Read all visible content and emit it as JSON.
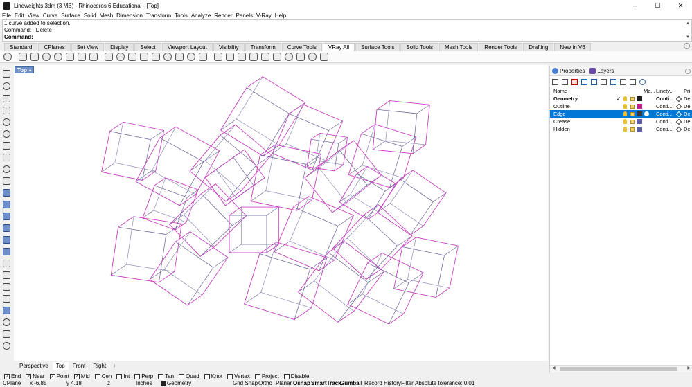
{
  "window": {
    "title": "Lineweights.3dm (3 MB) - Rhinoceros 6 Educational - [Top]",
    "controls": [
      "–",
      "☐",
      "✕"
    ]
  },
  "menu": [
    "File",
    "Edit",
    "View",
    "Curve",
    "Surface",
    "Solid",
    "Mesh",
    "Dimension",
    "Transform",
    "Tools",
    "Analyze",
    "Render",
    "Panels",
    "V-Ray",
    "Help"
  ],
  "command_history": [
    "1 curve added to selection.",
    "Command: _Delete"
  ],
  "command_prompt": "Command:",
  "toolbar_tabs": [
    "Standard",
    "CPlanes",
    "Set View",
    "Display",
    "Select",
    "Viewport Layout",
    "Visibility",
    "Transform",
    "Curve Tools",
    "VRay All",
    "Surface Tools",
    "Solid Tools",
    "Mesh Tools",
    "Render Tools",
    "Drafting",
    "New in V6"
  ],
  "active_toolbar_tab": "VRay All",
  "viewport": {
    "label": "Top",
    "caret": "▾",
    "tabs": [
      "Perspective",
      "Top",
      "Front",
      "Right"
    ],
    "active_tab": "Top",
    "add_tab": "+"
  },
  "panel": {
    "tabs": [
      {
        "label": "Properties",
        "icon": "properties-icon",
        "color": "#4a7fcf"
      },
      {
        "label": "Layers",
        "icon": "layers-icon",
        "color": "#6a4ca8"
      }
    ],
    "columns": {
      "name": "Name",
      "material": "Ma...",
      "linetype": "Linety...",
      "print": "Pri"
    },
    "layers": [
      {
        "name": "Geometry",
        "current": true,
        "check": "✓",
        "color": "#1a1a1a",
        "material": "",
        "linetype": "Conti...",
        "print": "De",
        "bold": true,
        "selected": false
      },
      {
        "name": "Outline",
        "current": false,
        "check": "",
        "color": "#c0208c",
        "material": "",
        "linetype": "Conti...",
        "print": "De",
        "bold": false,
        "selected": false
      },
      {
        "name": "Edge",
        "current": false,
        "check": "",
        "color": "#3a3a3a",
        "material": "#ffffff",
        "linetype": "Conti...",
        "print": "De",
        "bold": false,
        "selected": true
      },
      {
        "name": "Crease",
        "current": false,
        "check": "",
        "color": "#5b5ba8",
        "material": "",
        "linetype": "Conti...",
        "print": "De",
        "bold": false,
        "selected": false
      },
      {
        "name": "Hidden",
        "current": false,
        "check": "",
        "color": "#5b5ba8",
        "material": "",
        "linetype": "Conti...",
        "print": "De",
        "bold": false,
        "selected": false
      }
    ]
  },
  "osnaps": [
    {
      "label": "End",
      "checked": true
    },
    {
      "label": "Near",
      "checked": true
    },
    {
      "label": "Point",
      "checked": true
    },
    {
      "label": "Mid",
      "checked": true
    },
    {
      "label": "Cen",
      "checked": false
    },
    {
      "label": "Int",
      "checked": false
    },
    {
      "label": "Perp",
      "checked": false
    },
    {
      "label": "Tan",
      "checked": false
    },
    {
      "label": "Quad",
      "checked": false
    },
    {
      "label": "Knot",
      "checked": false
    },
    {
      "label": "Vertex",
      "checked": false
    },
    {
      "label": "Project",
      "checked": false
    },
    {
      "label": "Disable",
      "checked": false
    }
  ],
  "status": {
    "cplane": "CPlane",
    "x": "x -6.85",
    "y": "y 4.18",
    "z": "z",
    "units": "Inches",
    "layer": "Geometry",
    "grid_snap": "Grid Snap",
    "ortho": "Ortho",
    "planar": "Planar",
    "osnap": "Osnap",
    "smarttrack": "SmartTrack",
    "gumball": "Gumball",
    "record_history": "Record History",
    "filter": "Filter",
    "tolerance": "Absolute tolerance: 0.01"
  },
  "colors": {
    "outline": "#d23cc4",
    "edge": "#5f5c92",
    "crease": "#8b8bb6",
    "selection": "#0078d7",
    "viewport_label": "#6b8fc6"
  }
}
